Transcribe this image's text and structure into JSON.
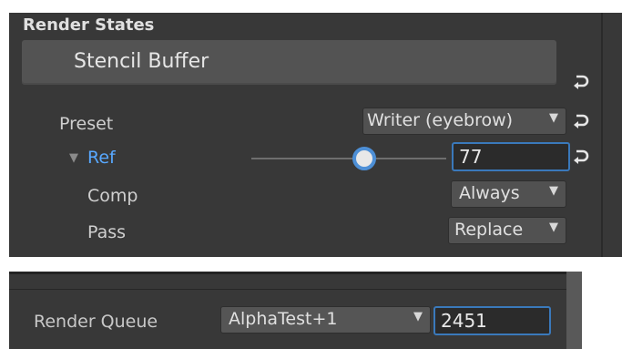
{
  "render_states": {
    "section_title": "Render States",
    "header_label": "Stencil Buffer",
    "preset": {
      "label": "Preset",
      "value": "Writer (eyebrow)"
    },
    "ref": {
      "label": "Ref",
      "value": "77",
      "slider_fraction": 0.5
    },
    "comp": {
      "label": "Comp",
      "value": "Always"
    },
    "pass": {
      "label": "Pass",
      "value": "Replace"
    }
  },
  "render_queue": {
    "label": "Render Queue",
    "dropdown_value": "AlphaTest+1",
    "value": "2451"
  },
  "icons": {
    "undo": "undo-arrow-icon",
    "caret": "caret-down-icon",
    "foldout": "foldout-triangle-icon"
  },
  "colors": {
    "panel_bg": "#383838",
    "accent_blue": "#4d8fd6",
    "label_blue": "#58a8ff"
  }
}
